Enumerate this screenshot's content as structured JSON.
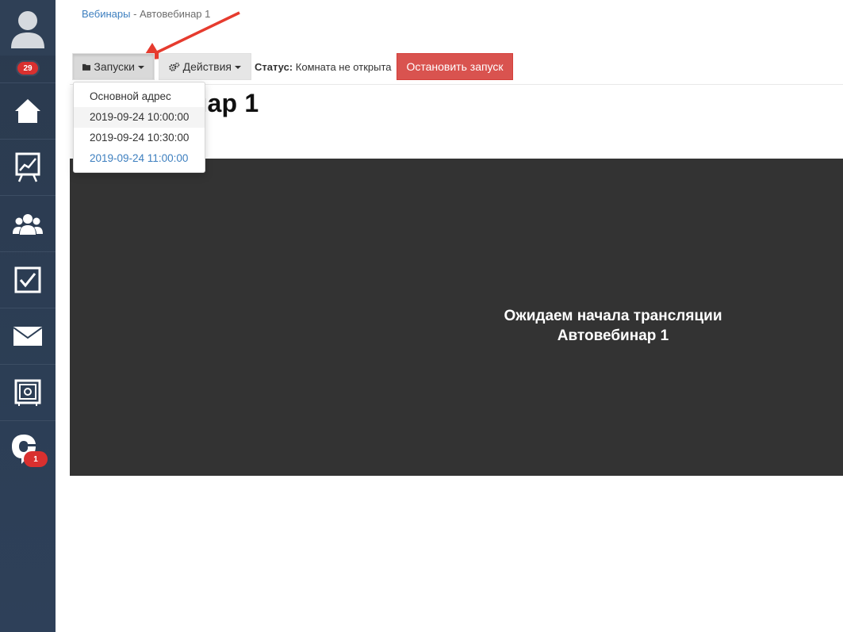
{
  "sidebar": {
    "notification_count": "29",
    "chat_badge": "1",
    "items": [
      {
        "icon": "home-icon"
      },
      {
        "icon": "presentation-chart-icon"
      },
      {
        "icon": "users-group-icon"
      },
      {
        "icon": "checkbox-icon"
      },
      {
        "icon": "envelope-icon"
      },
      {
        "icon": "safe-icon"
      },
      {
        "icon": "chat-logo-icon"
      }
    ]
  },
  "breadcrumb": {
    "parent": "Вебинары",
    "separator": " - ",
    "current": "Автовебинар 1"
  },
  "toolbar": {
    "launches_label": "Запуски",
    "actions_label": "Действия",
    "status_label": "Статус:",
    "status_value": "Комната не открыта",
    "stop_label": "Остановить запуск"
  },
  "page": {
    "title_visible": "нар 1"
  },
  "dropdown": {
    "items": [
      {
        "label": "Основной адрес"
      },
      {
        "label": "2019-09-24 10:00:00"
      },
      {
        "label": "2019-09-24 10:30:00"
      },
      {
        "label": "2019-09-24 11:00:00"
      }
    ]
  },
  "video": {
    "line1": "Ожидаем начала трансляции",
    "line2": "Автовебинар 1"
  },
  "colors": {
    "sidebar": "#2c3e55",
    "accent_link": "#3d7fbf",
    "danger": "#d9534f",
    "video_bg": "#333333",
    "badge": "#d9302f"
  }
}
